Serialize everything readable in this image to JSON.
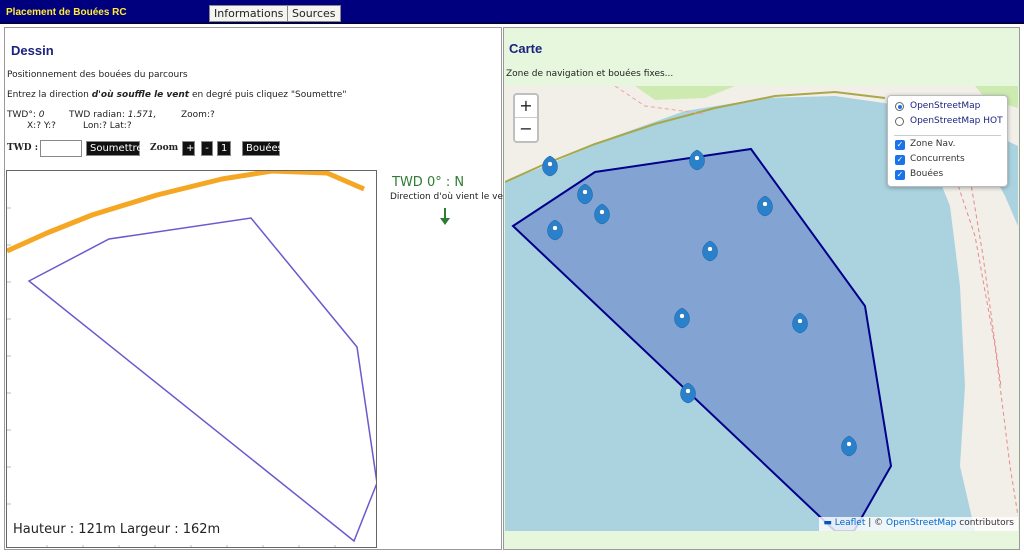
{
  "header": {
    "title": "Placement de Bouées RC",
    "info_button": "Informations",
    "sources_button": "Sources"
  },
  "dessin": {
    "title": "Dessin",
    "subtitle": "Positionnement des bouées du parcours",
    "instruction_pre": "Entrez la direction ",
    "instruction_em": "d'où souffle le vent",
    "instruction_post": " en degré puis cliquez \"Soumettre\"",
    "twd_deg_label": "TWD°: ",
    "twd_deg_value": "0",
    "twd_rad_label": "TWD radian: ",
    "twd_rad_value": "1.571,",
    "zoom_info": "Zoom:?",
    "xy_info": "X:? Y:?",
    "lonlat_info": "Lon:? Lat:?",
    "twd_label": "TWD :",
    "twd_input_value": "",
    "submit_button": "Soumettre",
    "zoom_label": "Zoom",
    "zoom_in": "+",
    "zoom_out": "-",
    "zoom_reset": "1",
    "buoys_button": "Bouées",
    "caption": "Hauteur : 121m  Largeur : 162m",
    "twd_display": "TWD 0° : N",
    "wind_desc": "Direction d'où vient le vent"
  },
  "carte": {
    "title": "Carte",
    "subtitle": "Zone de navigation et bouées fixes...",
    "zoom_in": "+",
    "zoom_out": "−",
    "layers": {
      "base": [
        {
          "label": "OpenStreetMap",
          "selected": true
        },
        {
          "label": "OpenStreetMap HOT",
          "selected": false
        }
      ],
      "overlays": [
        {
          "label": "Zone Nav.",
          "checked": true
        },
        {
          "label": "Concurrents",
          "checked": true
        },
        {
          "label": "Bouées",
          "checked": true
        }
      ]
    },
    "attribution_flag": "▬",
    "attribution_leaflet": "Leaflet",
    "attribution_sep": " | © ",
    "attribution_osm": "OpenStreetMap",
    "attribution_tail": " contributors",
    "marker_count": 14
  },
  "colors": {
    "header_bg": "#00007f",
    "header_title": "#ffee33",
    "wind_green": "#2e7d32",
    "course_orange": "#f5a623",
    "zone_outline": "#6a5acd",
    "water": "#aad3df",
    "zone_fill": "#7c9bd0",
    "marker_blue": "#2a81cb"
  }
}
